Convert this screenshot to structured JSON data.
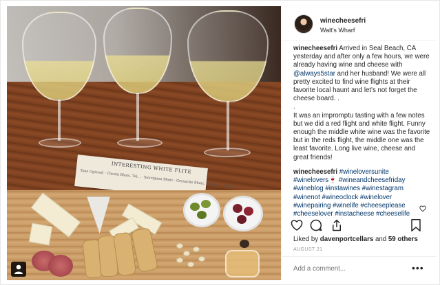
{
  "post": {
    "username": "winecheesefri",
    "location": "Walt's Wharf",
    "photo": {
      "card_title": "INTERESTING WHITE FLITE",
      "card_line": "Tooe Ogieroli · Chenin Blanc, Tal... · Sauvignon Blanc · Grenache Blanc, Opolinq · Gesell"
    },
    "caption": {
      "author": "winecheesefri",
      "p1_a": " Arrived in Seal Beach, CA yesterday and after only a few hours, we were already having wine and cheese with ",
      "mention": "@always5star",
      "p1_b": " and her husband! We were all pretty excited to find wine flights at their favorite local haunt and let's not forget the cheese board. .",
      "dot": ".",
      "p2": "It was an impromptu tasting with a few notes but we did a red flight and white flight. Funny enough the middle white wine was the favorite but in the reds flight, the middle one was the least favorite. Long live wine, cheese and great friends!"
    },
    "comment": {
      "author": "winecheesefri",
      "tags": [
        "#winelovers",
        "unite",
        "#winelovers",
        "🍷",
        "#wineandcheesefriday",
        "#wineblog",
        "#instawines",
        "#winestagram",
        "#winenot",
        "#wineoclock",
        "#winelover",
        "#winepairing",
        "#winelife",
        "#cheeseplease",
        "#cheeselover",
        "#instacheese",
        "#cheeselife"
      ],
      "text_line1": " #winelovers",
      "line1_tail": "unite",
      "line2_a": "#winelovers",
      "wine_emoji": "🍷",
      "line2_b": " #wineandcheesefriday",
      "line3": "#wineblog #instawines #winestagram",
      "line4": "#winenot #wineoclock #winelover",
      "line5": "#winepairing #winelife #cheeseplease",
      "line6": "#cheeselover #instacheese #cheeselife"
    },
    "likes": {
      "prefix": "Liked by ",
      "user": "davenportcellars",
      "middle": " and ",
      "others": "59 others"
    },
    "date": "AUGUST 21",
    "add_comment_placeholder": "Add a comment...",
    "more_label": "•••"
  },
  "colors": {
    "link": "#003569",
    "text": "#262626",
    "muted": "#999999"
  },
  "icons": [
    "heart-icon",
    "comment-icon",
    "share-icon",
    "bookmark-icon",
    "heart-small-icon",
    "user-tag-icon",
    "more-options-icon"
  ]
}
